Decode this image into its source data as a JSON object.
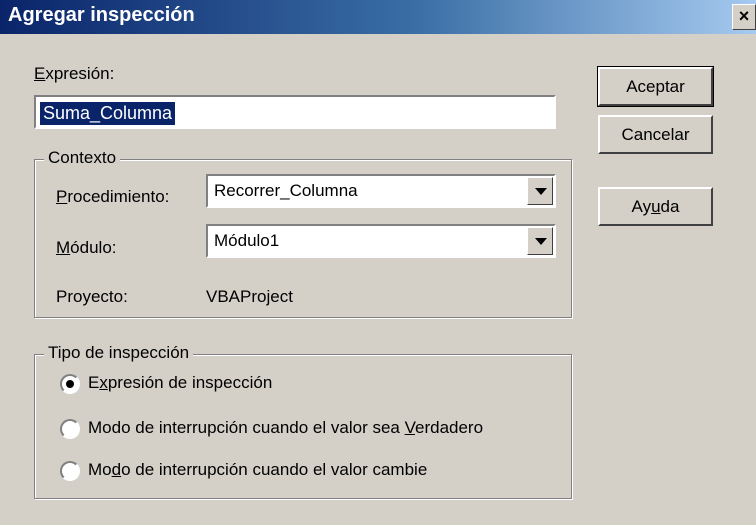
{
  "window": {
    "title": "Agregar inspección",
    "close_glyph": "×"
  },
  "expression": {
    "label": "Expresión:",
    "label_accel": "E",
    "label_rest": "xpresión:",
    "value": "Suma_Columna"
  },
  "context": {
    "title": "Contexto",
    "procedure": {
      "label_accel": "P",
      "label_rest": "rocedimiento:",
      "value": "Recorrer_Columna"
    },
    "module": {
      "label_accel": "M",
      "label_rest": "ódulo:",
      "value": "Módulo1"
    },
    "project": {
      "label": "Proyecto:",
      "value": "VBAProject"
    }
  },
  "watch_type": {
    "title": "Tipo de inspección",
    "selected_index": 0,
    "options": [
      {
        "pre": "E",
        "accel": "x",
        "post": "presión de inspección"
      },
      {
        "pre": "Modo de interrupción cuando el valor sea ",
        "accel": "V",
        "post": "erdadero"
      },
      {
        "pre": "Mo",
        "accel": "d",
        "post": "o de interrupción cuando el valor cambie"
      }
    ]
  },
  "buttons": {
    "ok": "Aceptar",
    "cancel": "Cancelar",
    "help_pre": "Ay",
    "help_accel": "u",
    "help_post": "da"
  }
}
